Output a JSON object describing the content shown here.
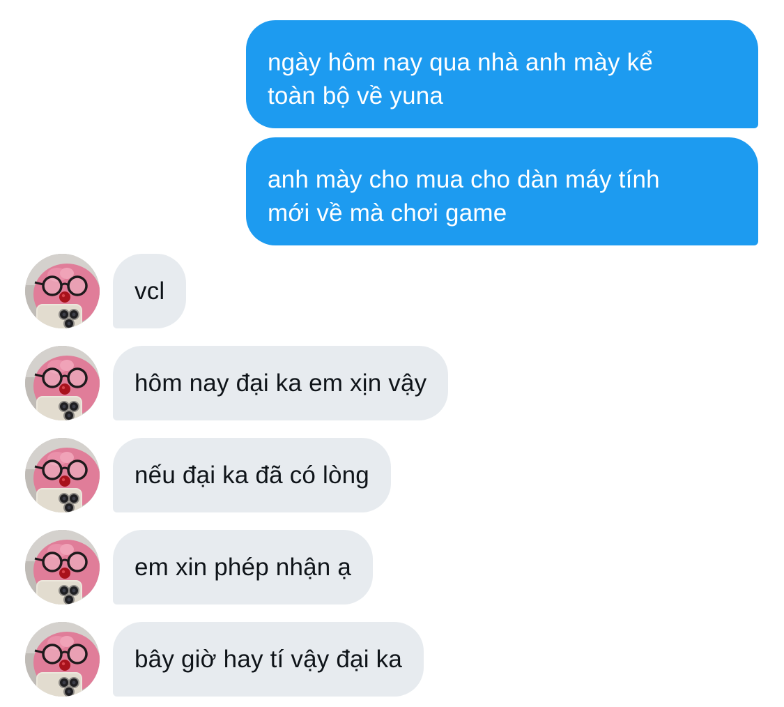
{
  "conversation": {
    "sent": [
      {
        "lines": [
          "ngày hôm nay qua nhà anh mày kể",
          "toàn bộ về yuna"
        ]
      },
      {
        "lines": [
          "anh mày cho mua cho dàn máy tính",
          "mới về mà chơi game"
        ]
      }
    ],
    "received": [
      {
        "text": "vcl"
      },
      {
        "text": "hôm nay đại ka em xịn vậy"
      },
      {
        "text": "nếu đại ka đã có lòng"
      },
      {
        "text": "em xin phép nhận ạ"
      },
      {
        "text": "bây giờ hay tí vậy đại ka"
      }
    ]
  },
  "colors": {
    "sent_bubble": "#1d9bf0",
    "received_bubble": "#e7ebef",
    "received_text": "#0f1419"
  },
  "icons": {
    "avatar": "pink-plush-with-glasses-holding-phone-avatar"
  }
}
